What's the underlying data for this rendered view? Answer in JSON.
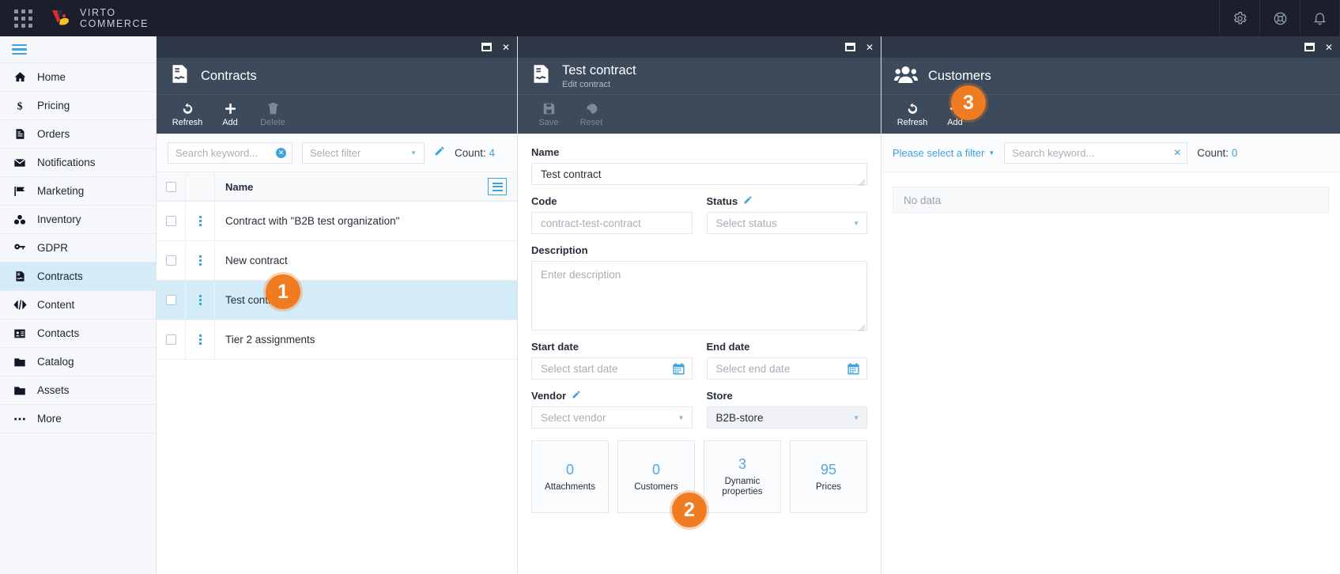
{
  "topbar": {
    "brand_line1": "VIRTO",
    "brand_line2": "COMMERCE",
    "apps_icon": "apps-grid-icon",
    "icons": [
      {
        "name": "settings-icon",
        "label": "Settings"
      },
      {
        "name": "help-icon",
        "label": "Help"
      },
      {
        "name": "notifications-bell-icon",
        "label": "Notifications"
      }
    ]
  },
  "sidebar": {
    "menu_toggle": "hamburger-menu",
    "items": [
      {
        "label": "Home",
        "icon": "home-icon",
        "active": false
      },
      {
        "label": "Pricing",
        "icon": "dollar-icon",
        "active": false
      },
      {
        "label": "Orders",
        "icon": "document-list-icon",
        "active": false
      },
      {
        "label": "Notifications",
        "icon": "envelope-icon",
        "active": false
      },
      {
        "label": "Marketing",
        "icon": "flag-icon",
        "active": false
      },
      {
        "label": "Inventory",
        "icon": "boxes-icon",
        "active": false
      },
      {
        "label": "GDPR",
        "icon": "key-icon",
        "active": false
      },
      {
        "label": "Contracts",
        "icon": "contract-icon",
        "active": true
      },
      {
        "label": "Content",
        "icon": "code-icon",
        "active": false
      },
      {
        "label": "Contacts",
        "icon": "id-card-icon",
        "active": false
      },
      {
        "label": "Catalog",
        "icon": "folder-filled-icon",
        "active": false
      },
      {
        "label": "Assets",
        "icon": "folder-outline-icon",
        "active": false
      },
      {
        "label": "More",
        "icon": "ellipsis-icon",
        "active": false
      }
    ]
  },
  "contracts_blade": {
    "title": "Contracts",
    "icon": "contract-icon",
    "chrome": {
      "minimize": "minimize-icon",
      "close": "close-icon"
    },
    "toolbar": [
      {
        "label": "Refresh",
        "icon": "refresh-icon",
        "disabled": false
      },
      {
        "label": "Add",
        "icon": "plus-icon",
        "disabled": false
      },
      {
        "label": "Delete",
        "icon": "trash-icon",
        "disabled": true
      }
    ],
    "search_placeholder": "Search keyword...",
    "filter_placeholder": "Select filter",
    "edit_filter_icon": "pencil-icon",
    "count_label": "Count:",
    "count_value": "4",
    "columns": [
      "Name"
    ],
    "rows": [
      {
        "name": "Contract with \"B2B test organization\"",
        "selected": false
      },
      {
        "name": "New contract",
        "selected": false
      },
      {
        "name": "Test contract",
        "selected": true
      },
      {
        "name": "Tier 2 assignments",
        "selected": false
      }
    ]
  },
  "contract_editor_blade": {
    "title": "Test contract",
    "subtitle": "Edit contract",
    "icon": "contract-icon",
    "chrome": {
      "minimize": "minimize-icon",
      "close": "close-icon"
    },
    "toolbar": [
      {
        "label": "Save",
        "icon": "save-icon",
        "disabled": true
      },
      {
        "label": "Reset",
        "icon": "reset-icon",
        "disabled": true
      }
    ],
    "fields": {
      "name_label": "Name",
      "name_value": "Test contract",
      "code_label": "Code",
      "code_placeholder": "contract-test-contract",
      "status_label": "Status",
      "status_placeholder": "Select status",
      "status_edit_icon": "pencil-icon",
      "description_label": "Description",
      "description_placeholder": "Enter description",
      "start_date_label": "Start date",
      "start_date_placeholder": "Select start date",
      "end_date_label": "End date",
      "end_date_placeholder": "Select end date",
      "vendor_label": "Vendor",
      "vendor_edit_icon": "pencil-icon",
      "vendor_placeholder": "Select vendor",
      "store_label": "Store",
      "store_value": "B2B-store"
    },
    "cards": [
      {
        "value": "0",
        "label": "Attachments"
      },
      {
        "value": "0",
        "label": "Customers"
      },
      {
        "value": "3",
        "label": "Dynamic properties"
      },
      {
        "value": "95",
        "label": "Prices"
      }
    ]
  },
  "customers_blade": {
    "title": "Customers",
    "icon": "customers-icon",
    "chrome": {
      "minimize": "minimize-icon",
      "close": "close-icon"
    },
    "toolbar": [
      {
        "label": "Refresh",
        "icon": "refresh-icon",
        "disabled": false
      },
      {
        "label": "Add",
        "icon": "plus-icon",
        "disabled": false
      }
    ],
    "filter_link": "Please select a filter",
    "search_placeholder": "Search keyword...",
    "count_label": "Count:",
    "count_value": "0",
    "empty_text": "No data"
  },
  "markers": [
    {
      "id": "1",
      "label": "1"
    },
    {
      "id": "2",
      "label": "2"
    },
    {
      "id": "3",
      "label": "3"
    }
  ],
  "colors": {
    "accent": "#3fa2dd",
    "marker": "#f07c22",
    "blade_header": "#3d4a5c",
    "topbar": "#1a1f2b",
    "selected_row": "#d4ecf7"
  }
}
